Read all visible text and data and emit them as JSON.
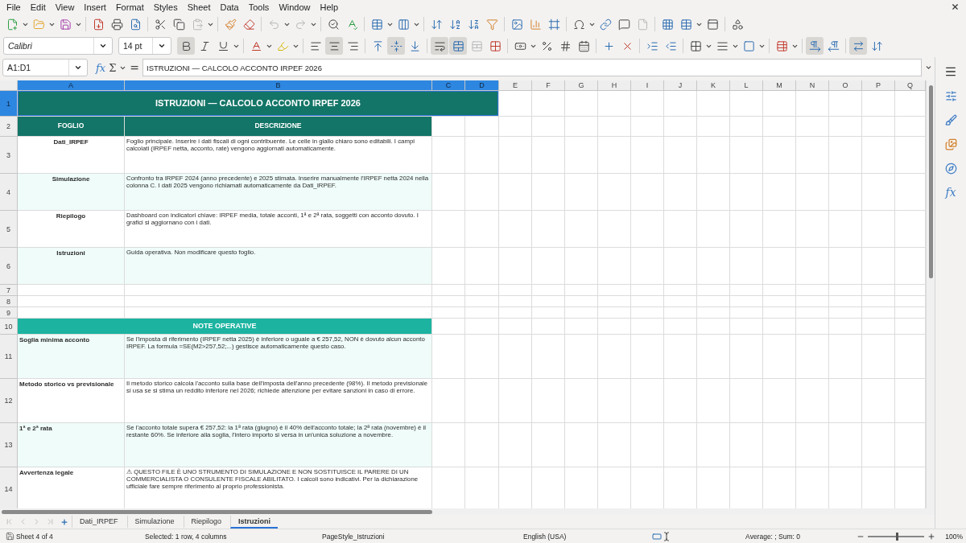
{
  "menu": [
    "File",
    "Edit",
    "View",
    "Insert",
    "Format",
    "Styles",
    "Sheet",
    "Data",
    "Tools",
    "Window",
    "Help"
  ],
  "standard_toolbar": {
    "paste_enabled": false,
    "undo_enabled": false,
    "redo_enabled": false
  },
  "format_toolbar": {
    "font": "Calibri",
    "size": "14 pt",
    "bold": true,
    "italic": false,
    "underline": false,
    "align_left": false,
    "align_center": true,
    "align_right": false,
    "align_top": false,
    "align_middle": true,
    "align_bottom": false,
    "wrap_text": true,
    "merge": true,
    "left_to_right": true,
    "horizontal_text": true
  },
  "formula_bar": {
    "name_box": "A1:D1",
    "function_label": "fx",
    "sum": "Σ",
    "equals": "=",
    "content": "ISTRUZIONI — CALCOLO ACCONTO IRPEF 2026"
  },
  "columns": [
    {
      "label": "A",
      "selected": true
    },
    {
      "label": "B",
      "selected": true
    },
    {
      "label": "C",
      "selected": true
    },
    {
      "label": "D",
      "selected": true
    },
    {
      "label": "E",
      "selected": false
    },
    {
      "label": "F",
      "selected": false
    },
    {
      "label": "G",
      "selected": false
    },
    {
      "label": "H",
      "selected": false
    },
    {
      "label": "I",
      "selected": false
    },
    {
      "label": "J",
      "selected": false
    },
    {
      "label": "K",
      "selected": false
    },
    {
      "label": "L",
      "selected": false
    },
    {
      "label": "M",
      "selected": false
    },
    {
      "label": "N",
      "selected": false
    },
    {
      "label": "O",
      "selected": false
    },
    {
      "label": "P",
      "selected": false
    },
    {
      "label": "Q",
      "selected": false
    }
  ],
  "rows": [
    {
      "number": "1",
      "selected": true,
      "kind": "title",
      "text": "ISTRUZIONI — CALCOLO ACCONTO IRPEF 2026"
    },
    {
      "number": "2",
      "selected": false,
      "kind": "header",
      "cells": [
        "FOGLIO",
        "DESCRIZIONE"
      ]
    },
    {
      "number": "3",
      "selected": false,
      "kind": "entry",
      "banded": false,
      "cells": [
        "Dati_IRPEF",
        "Foglio principale. Inserire i dati fiscali di ogni contribuente. Le celle in giallo chiaro sono editabili. I campi calcolati (IRPEF netta, acconto, rate) vengono aggiornati automaticamente."
      ]
    },
    {
      "number": "4",
      "selected": false,
      "kind": "entry",
      "banded": true,
      "cells": [
        "Simulazione",
        "Confronto tra IRPEF 2024 (anno precedente) e 2025 stimata. Inserire manualmente l'IRPEF netta 2024 nella colonna C. I dati 2025 vengono richiamati automaticamente da Dati_IRPEF."
      ]
    },
    {
      "number": "5",
      "selected": false,
      "kind": "entry",
      "banded": false,
      "cells": [
        "Riepilogo",
        "Dashboard con indicatori chiave: IRPEF media, totale acconti, 1ª e 2ª rata, soggetti con acconto dovuto. I grafici si aggiornano con i dati."
      ]
    },
    {
      "number": "6",
      "selected": false,
      "kind": "entry",
      "banded": true,
      "cells": [
        "Istruzioni",
        "Guida operativa. Non modificare questo foglio."
      ]
    },
    {
      "number": "7",
      "selected": false,
      "kind": "empty"
    },
    {
      "number": "8",
      "selected": false,
      "kind": "empty"
    },
    {
      "number": "9",
      "selected": false,
      "kind": "empty"
    },
    {
      "number": "10",
      "selected": false,
      "kind": "section",
      "text": "NOTE OPERATIVE"
    },
    {
      "number": "11",
      "selected": false,
      "kind": "note",
      "banded": true,
      "cells": [
        "Soglia minima acconto",
        "Se l'imposta di riferimento (IRPEF netta 2025) è inferiore o uguale a € 257,52, NON è dovuto alcun acconto IRPEF. La formula =SE(M2>257,52;...) gestisce automaticamente questo caso."
      ]
    },
    {
      "number": "12",
      "selected": false,
      "kind": "note",
      "banded": false,
      "cells": [
        "Metodo storico vs previsionale",
        "Il metodo storico calcola l'acconto sulla base dell'imposta dell'anno precedente (98%). Il metodo previsionale si usa se si stima un reddito inferiore nel 2026; richiede attenzione per evitare sanzioni in caso di errore."
      ]
    },
    {
      "number": "13",
      "selected": false,
      "kind": "note",
      "banded": true,
      "cells": [
        "1ª e 2ª rata",
        "Se l'acconto totale supera € 257,52: la 1ª rata (giugno) è il 40% dell'acconto totale; la 2ª rata (novembre) è il restante 60%. Se inferiore alla soglia, l'intero importo si versa in un'unica soluzione a novembre."
      ]
    },
    {
      "number": "14",
      "selected": false,
      "kind": "note",
      "banded": false,
      "cells": [
        "Avvertenza legale",
        "⚠  QUESTO FILE È UNO STRUMENTO DI SIMULAZIONE E NON SOSTITUISCE IL PARERE DI UN COMMERCIALISTA O CONSULENTE FISCALE ABILITATO. I calcoli sono indicativi. Per la dichiarazione ufficiale fare sempre riferimento al proprio professionista."
      ]
    }
  ],
  "sheet_tabs": [
    {
      "label": "Dati_IRPEF",
      "selected": false
    },
    {
      "label": "Simulazione",
      "selected": false
    },
    {
      "label": "Riepilogo",
      "selected": false
    },
    {
      "label": "Istruzioni",
      "selected": true
    }
  ],
  "sidebar": {
    "function_label": "fx"
  },
  "status_bar": {
    "sheet": "Sheet 4 of 4",
    "selection": "Selected: 1 row, 4 columns",
    "page_style": "PageStyle_Istruzioni",
    "language": "English (USA)",
    "sum": "Average: ; Sum: 0",
    "zoom": {
      "label": "100%",
      "level": 0.5
    }
  }
}
